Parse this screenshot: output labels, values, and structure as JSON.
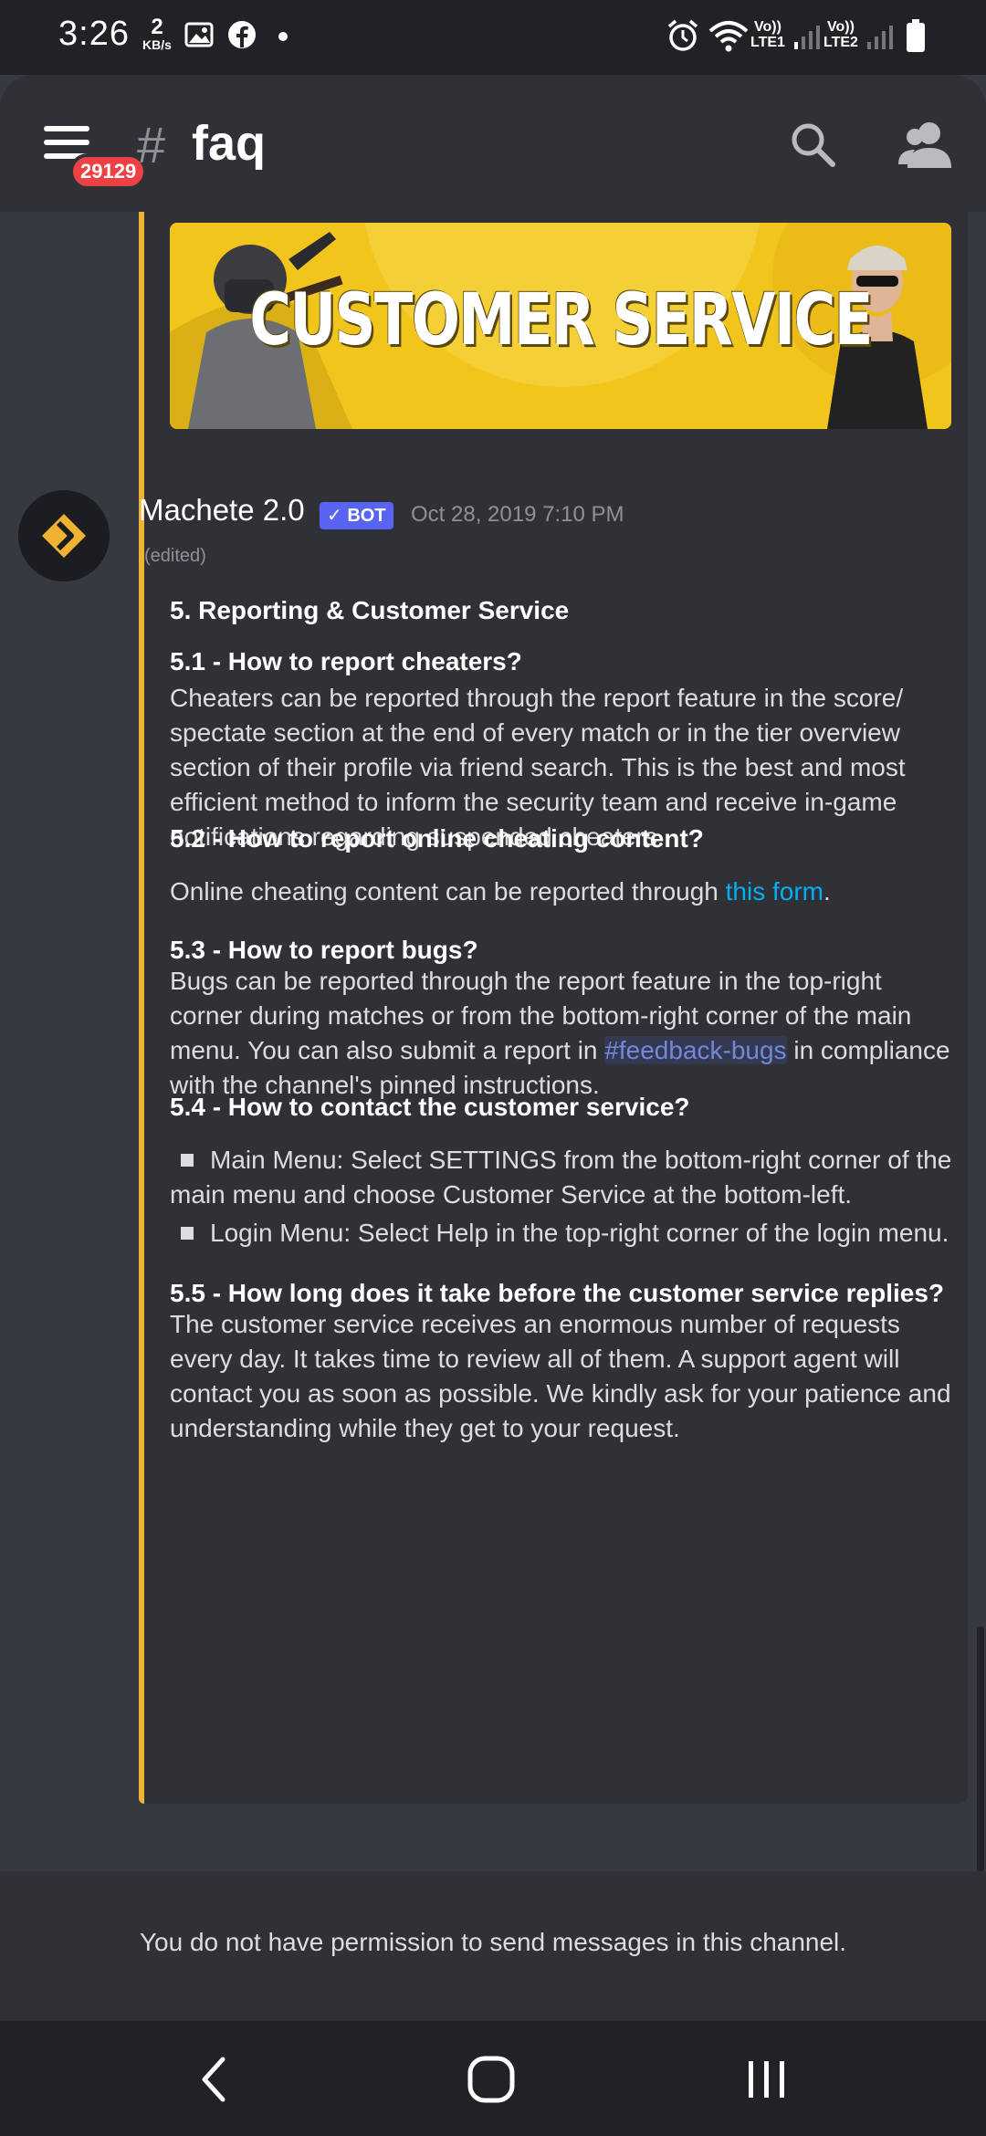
{
  "status_bar": {
    "time": "3:26",
    "net_speed_value": "2",
    "net_speed_unit": "KB/s",
    "sim1_label_top": "Vo))",
    "sim1_label_bottom": "LTE1",
    "sim2_label_top": "Vo))",
    "sim2_label_bottom": "LTE2",
    "icons": [
      "gallery-icon",
      "facebook-icon",
      "notification-dot-icon",
      "alarm-icon",
      "wifi-icon",
      "signal-icon",
      "battery-icon"
    ]
  },
  "header": {
    "badge_count": "29129",
    "hash": "#",
    "channel_name": "faq",
    "icons": [
      "menu-icon",
      "search-icon",
      "members-icon"
    ]
  },
  "banner": {
    "text": "CUSTOMER SERVICE",
    "colors": {
      "background": "#f2c51c",
      "accent": "#f0b232"
    }
  },
  "message": {
    "author": "Machete 2.0",
    "bot_tag": "✓ BOT",
    "timestamp": "Oct 28, 2019 7:10 PM",
    "edited": "(edited)"
  },
  "embed": {
    "title": "5. Reporting & Customer Service",
    "s51_heading": "5.1 - How to report cheaters?",
    "s51_body": "Cheaters can be reported through the report feature in the score/ spectate section at the end of every match or in the tier overview section of their profile via friend search. This is the best and most efficient method to inform the security team and receive in-game notifications regarding suspended cheaters.",
    "s52_heading": "5.2 - How to report online cheating content?",
    "s52_body_pre": "Online cheating content can be reported through ",
    "s52_link": "this form",
    "s52_body_post": ".",
    "s53_heading": "5.3 - How to report bugs?",
    "s53_body_pre": "Bugs can be reported through the report feature in the top-right corner during matches or from the bottom-right corner of the main menu. You can also submit a report in ",
    "s53_mention": "#feedback-bugs",
    "s53_body_post": " in compliance with the channel's pinned instructions.",
    "s54_heading": "5.4 - How to contact the customer service?",
    "s54_bullet1": "Main Menu: Select SETTINGS from the bottom-right corner of the main menu and choose Customer Service at the bottom-left.",
    "s54_bullet2": "Login Menu: Select Help in the top-right corner of the login menu.",
    "s55_heading": "5.5 - How long does it take before the customer service replies?",
    "s55_body": "The customer service receives an enormous number of requests every day. It takes time to review all of them. A support agent will contact you as soon as possible. We kindly ask for your patience and understanding while they get to your request."
  },
  "footer": {
    "permission_text": "You do not have permission to send messages in this channel."
  },
  "navbar": {
    "icons": [
      "back-icon",
      "home-icon",
      "recents-icon"
    ]
  },
  "colors": {
    "chat_bg": "#36393f",
    "header_bg": "#2f3136",
    "embed_border": "#f0b232",
    "link": "#00aff4",
    "mention": "#7289da",
    "badge": "#ed4245",
    "bot_tag": "#5865f2"
  }
}
